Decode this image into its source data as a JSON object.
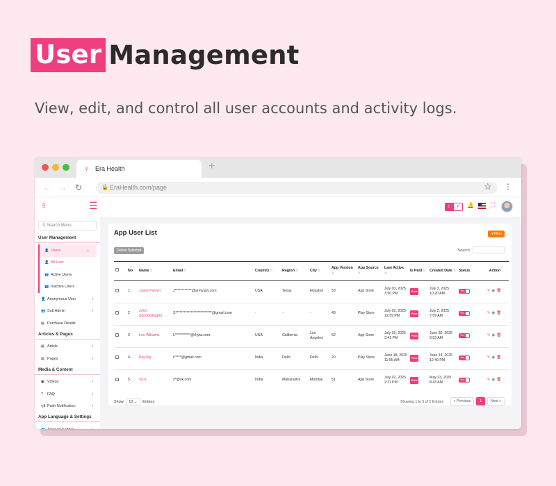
{
  "hero": {
    "title_highlight": "User",
    "title_rest": "Management",
    "subtitle": "View, edit, and control all user accounts and activity logs."
  },
  "browser": {
    "tab_title": "Era Health",
    "new_tab_icon": "+",
    "url": "EraHealth.com/page"
  },
  "colors": {
    "accent": "#ef3e7d",
    "filter": "#ff7a00",
    "background": "#fde9ef"
  },
  "sidebar": {
    "search_placeholder": "Search Menu",
    "sections": [
      {
        "title": "User Management",
        "items": [
          {
            "label": "Users",
            "icon": "user-icon",
            "chevron": "⌄",
            "active": true
          },
          {
            "label": "All User",
            "icon": "user-icon",
            "sub": true,
            "current": true
          },
          {
            "label": "Active Users",
            "icon": "users-icon",
            "sub": true
          },
          {
            "label": "Inactive Users",
            "icon": "users-icon",
            "sub": true
          },
          {
            "label": "Anonymous User",
            "icon": "user-icon",
            "chevron": "›"
          },
          {
            "label": "Sub Admin",
            "icon": "users-icon",
            "chevron": "›"
          },
          {
            "label": "Purchase Details",
            "icon": "document-icon"
          }
        ]
      },
      {
        "title": "Articles & Pages",
        "items": [
          {
            "label": "Article",
            "icon": "document-icon",
            "chevron": "›"
          },
          {
            "label": "Pages",
            "icon": "document-icon",
            "chevron": "›"
          }
        ]
      },
      {
        "title": "Media & Content",
        "items": [
          {
            "label": "Videos",
            "icon": "video-icon",
            "chevron": "›"
          },
          {
            "label": "FAQ",
            "icon": "question-icon",
            "chevron": "›"
          },
          {
            "label": "Push Notification",
            "icon": "megaphone-icon",
            "chevron": "›"
          }
        ]
      },
      {
        "title": "App Language & Settings",
        "items": [
          {
            "label": "Account Setting",
            "icon": "users-icon",
            "chevron": "›"
          }
        ]
      }
    ]
  },
  "card": {
    "title": "App User List",
    "filter_label": "Filter",
    "delete_label": "Delete Selected",
    "search_label": "Search",
    "columns": [
      "No",
      "Name",
      "Email",
      "Country",
      "Region",
      "City",
      "App Version",
      "App Source",
      "Last Active",
      "Is Paid",
      "Created Date",
      "Status",
      "Action"
    ],
    "rows": [
      {
        "no": "1",
        "name": "Justin Palmer",
        "email": "J************@armyspy.com",
        "country": "USA",
        "region": "Texas",
        "city": "Houston",
        "version": "53",
        "source": "App Store",
        "last_active": "July 03, 2025 3:50 PM",
        "paid": "Free",
        "created": "July 3, 2025 10:20 AM",
        "status": "Yes"
      },
      {
        "no": "2",
        "name": "John Spoonbillag93",
        "email": "S**************************@gmail.com",
        "country": "-",
        "region": "-",
        "city": "-",
        "version": "49",
        "source": "Play Store",
        "last_active": "July 02, 2025 12:39 PM",
        "paid": "Free",
        "created": "July 2, 2025 7:09 AM",
        "status": "Yes"
      },
      {
        "no": "3",
        "name": "Leo Williams",
        "email": "L***********@rhyta.com",
        "country": "USA",
        "region": "California",
        "city": "Los Angeles",
        "version": "52",
        "source": "App Store",
        "last_active": "July 02, 2025 3:41 PM",
        "paid": "Free",
        "created": "June 30, 2025 9:53 AM",
        "status": "Yes"
      },
      {
        "no": "4",
        "name": "Raj Raj",
        "email": "r*****@gmail.com",
        "country": "India",
        "region": "Delhi",
        "city": "Delhi",
        "version": "20",
        "source": "Play Store",
        "last_active": "June 18, 2025 11:55 AM",
        "paid": "Free",
        "created": "June 14, 2025 12:40 PM",
        "status": "Yes"
      },
      {
        "no": "5",
        "name": "Sk K",
        "email": "s*@sk.com",
        "country": "India",
        "region": "Maharastra",
        "city": "Mumbai",
        "version": "51",
        "source": "App Store",
        "last_active": "July 02, 2025 2:11 PM",
        "paid": "Free",
        "created": "May 23, 2025 8:43 AM",
        "status": "Yes"
      }
    ],
    "footer": {
      "show_label": "Show",
      "show_value": "10",
      "entries_label": "Entries",
      "showing_text": "Showing 1 to 5 of 5 Entries",
      "prev_label": "« Previous",
      "page": "1",
      "next_label": "Next »"
    }
  }
}
